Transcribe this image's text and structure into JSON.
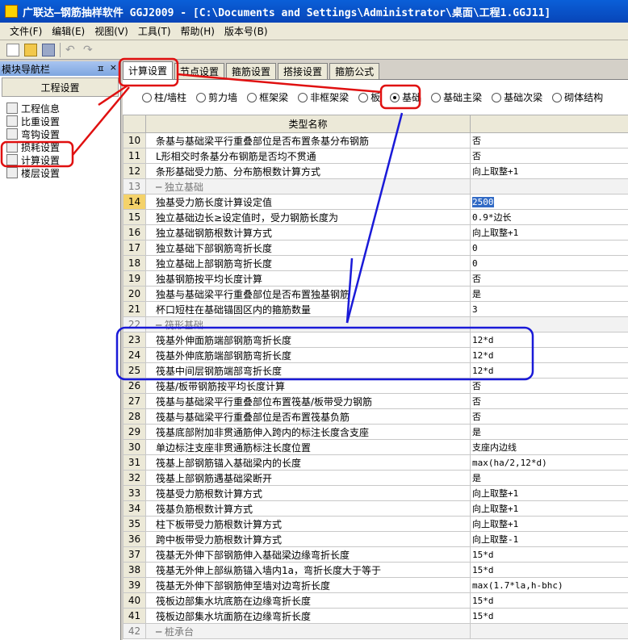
{
  "window": {
    "title": "广联达—钢筋抽样软件 GGJ2009 - [C:\\Documents and Settings\\Administrator\\桌面\\工程1.GGJ11]"
  },
  "menu": [
    "文件(F)",
    "编辑(E)",
    "视图(V)",
    "工具(T)",
    "帮助(H)",
    "版本号(B)"
  ],
  "nav": {
    "title": "模块导航栏",
    "pin": "ㅍ",
    "close": "×",
    "section": "工程设置",
    "items": [
      "工程信息",
      "比重设置",
      "弯钩设置",
      "损耗设置",
      "计算设置",
      "楼层设置"
    ]
  },
  "tabs": [
    "计算设置",
    "节点设置",
    "箍筋设置",
    "搭接设置",
    "箍筋公式"
  ],
  "radios": [
    "柱/墙柱",
    "剪力墙",
    "框架梁",
    "非框架梁",
    "板",
    "基础",
    "基础主梁",
    "基础次梁",
    "砌体结构"
  ],
  "grid": {
    "header": "类型名称",
    "rows": [
      {
        "n": "10",
        "name": "条基与基础梁平行重叠部位是否布置条基分布钢筋",
        "val": "否"
      },
      {
        "n": "11",
        "name": "L形相交时条基分布钢筋是否均不贯通",
        "val": "否"
      },
      {
        "n": "12",
        "name": "条形基础受力筋、分布筋根数计算方式",
        "val": "向上取整+1"
      },
      {
        "n": "13",
        "name": "独立基础",
        "val": ""
      },
      {
        "n": "14",
        "name": "独基受力筋长度计算设定值",
        "val": "2500"
      },
      {
        "n": "15",
        "name": "独立基础边长≥设定值时，受力钢筋长度为",
        "val": "0.9*边长"
      },
      {
        "n": "16",
        "name": "独立基础钢筋根数计算方式",
        "val": "向上取整+1"
      },
      {
        "n": "17",
        "name": "独立基础下部钢筋弯折长度",
        "val": "0"
      },
      {
        "n": "18",
        "name": "独立基础上部钢筋弯折长度",
        "val": "0"
      },
      {
        "n": "19",
        "name": "独基钢筋按平均长度计算",
        "val": "否"
      },
      {
        "n": "20",
        "name": "独基与基础梁平行重叠部位是否布置独基钢筋",
        "val": "是"
      },
      {
        "n": "21",
        "name": "杯口短柱在基础锚固区内的箍筋数量",
        "val": "3"
      },
      {
        "n": "22",
        "name": "筏形基础",
        "val": ""
      },
      {
        "n": "23",
        "name": "筏基外伸面筋端部钢筋弯折长度",
        "val": "12*d"
      },
      {
        "n": "24",
        "name": "筏基外伸底筋端部钢筋弯折长度",
        "val": "12*d"
      },
      {
        "n": "25",
        "name": "筏基中间层钢筋端部弯折长度",
        "val": "12*d"
      },
      {
        "n": "26",
        "name": "筏基/板带钢筋按平均长度计算",
        "val": "否"
      },
      {
        "n": "27",
        "name": "筏基与基础梁平行重叠部位布置筏基/板带受力钢筋",
        "val": "否"
      },
      {
        "n": "28",
        "name": "筏基与基础梁平行重叠部位是否布置筏基负筋",
        "val": "否"
      },
      {
        "n": "29",
        "name": "筏基底部附加非贯通筋伸入跨内的标注长度含支座",
        "val": "是"
      },
      {
        "n": "30",
        "name": "单边标注支座非贯通筋标注长度位置",
        "val": "支座内边线"
      },
      {
        "n": "31",
        "name": "筏基上部钢筋锚入基础梁内的长度",
        "val": "max(ha/2,12*d)"
      },
      {
        "n": "32",
        "name": "筏基上部钢筋遇基础梁断开",
        "val": "是"
      },
      {
        "n": "33",
        "name": "筏基受力筋根数计算方式",
        "val": "向上取整+1"
      },
      {
        "n": "34",
        "name": "筏基负筋根数计算方式",
        "val": "向上取整+1"
      },
      {
        "n": "35",
        "name": "柱下板带受力筋根数计算方式",
        "val": "向上取整+1"
      },
      {
        "n": "36",
        "name": "跨中板带受力筋根数计算方式",
        "val": "向上取整-1"
      },
      {
        "n": "37",
        "name": "筏基无外伸下部钢筋伸入基础梁边缘弯折长度",
        "val": "15*d"
      },
      {
        "n": "38",
        "name": "筏基无外伸上部纵筋锚入墙内1a，弯折长度大于等于",
        "val": "15*d"
      },
      {
        "n": "39",
        "name": "筏基无外伸下部钢筋伸至墙对边弯折长度",
        "val": "max(1.7*la,h-bhc)"
      },
      {
        "n": "40",
        "name": "筏板边部集水坑底筋在边缘弯折长度",
        "val": "15*d"
      },
      {
        "n": "41",
        "name": "筏板边部集水坑面筋在边缘弯折长度",
        "val": "15*d"
      },
      {
        "n": "42",
        "name": "桩承台",
        "val": ""
      }
    ]
  }
}
